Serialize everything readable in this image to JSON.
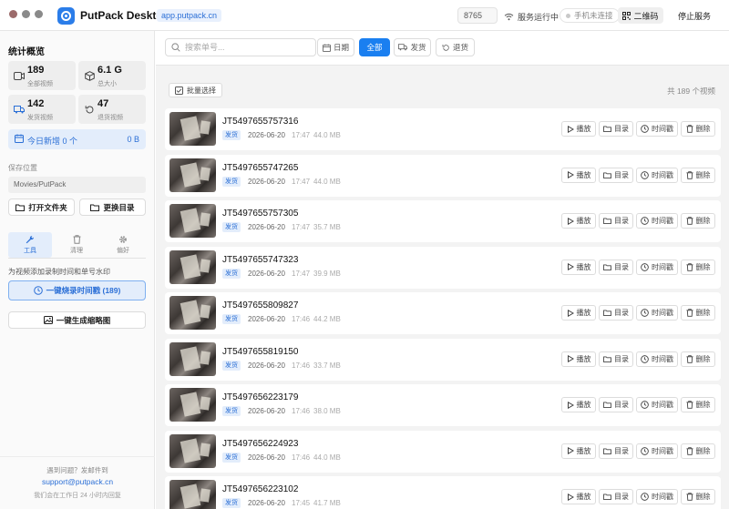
{
  "app": {
    "title": "PutPack Desktop",
    "domain": "app.putpack.cn",
    "port": "8765",
    "service_status": "服务运行中",
    "phone_status": "手机未连接",
    "qr_button": "二维码",
    "stop_button": "停止服务"
  },
  "colors": {
    "accent": "#1a7ff0",
    "accent_soft": "#e3edfb",
    "tag_text": "#2b6fd6"
  },
  "sidebar": {
    "title": "统计概览",
    "stats": [
      {
        "value": "189",
        "label": "全部视频",
        "icon": "video-icon"
      },
      {
        "value": "6.1 G",
        "label": "总大小",
        "icon": "box-icon"
      },
      {
        "value": "142",
        "label": "发货视频",
        "icon": "truck-icon"
      },
      {
        "value": "47",
        "label": "退货视频",
        "icon": "return-icon"
      }
    ],
    "today": {
      "label": "今日新增 0 个",
      "value": "0 B"
    },
    "save_label": "保存位置",
    "save_path": "Movies/PutPack",
    "open_folder": "打开文件夹",
    "change_dir": "更换目录",
    "tabs": [
      {
        "label": "工具",
        "icon": "wrench-icon",
        "active": true
      },
      {
        "label": "清理",
        "icon": "trash-icon",
        "active": false
      },
      {
        "label": "偏好",
        "icon": "gear-icon",
        "active": false
      }
    ],
    "tools_desc": "为视频添加录制时间和单号水印",
    "burn_button": "一键烧录时间戳 (189)",
    "thumb_button": "一键生成缩略图",
    "footer": {
      "question": "遇到问题？发邮件到",
      "email": "support@putpack.cn",
      "note": "我们会在工作日 24 小时内回复"
    }
  },
  "toolbar": {
    "search_placeholder": "搜索单号...",
    "date_button": "日期",
    "filter_all": "全部",
    "filter_ship": "发货",
    "filter_return": "退货"
  },
  "list": {
    "batch_select": "批量选择",
    "total": "共 189 个视频",
    "actions": {
      "play": "播放",
      "folder": "目录",
      "timestamp": "时间戳",
      "delete": "删除"
    },
    "rows": [
      {
        "code": "JT5497655757316",
        "tag": "发货",
        "date": "2026-06-20",
        "time": "17:47",
        "size": "44.0 MB"
      },
      {
        "code": "JT5497655747265",
        "tag": "发货",
        "date": "2026-06-20",
        "time": "17:47",
        "size": "44.0 MB"
      },
      {
        "code": "JT5497655757305",
        "tag": "发货",
        "date": "2026-06-20",
        "time": "17:47",
        "size": "35.7 MB"
      },
      {
        "code": "JT5497655747323",
        "tag": "发货",
        "date": "2026-06-20",
        "time": "17:47",
        "size": "39.9 MB"
      },
      {
        "code": "JT5497655809827",
        "tag": "发货",
        "date": "2026-06-20",
        "time": "17:46",
        "size": "44.2 MB"
      },
      {
        "code": "JT5497655819150",
        "tag": "发货",
        "date": "2026-06-20",
        "time": "17:46",
        "size": "33.7 MB"
      },
      {
        "code": "JT5497656223179",
        "tag": "发货",
        "date": "2026-06-20",
        "time": "17:46",
        "size": "38.0 MB"
      },
      {
        "code": "JT5497656224923",
        "tag": "发货",
        "date": "2026-06-20",
        "time": "17:46",
        "size": "44.0 MB"
      },
      {
        "code": "JT5497656223102",
        "tag": "发货",
        "date": "2026-06-20",
        "time": "17:45",
        "size": "41.7 MB"
      }
    ]
  }
}
